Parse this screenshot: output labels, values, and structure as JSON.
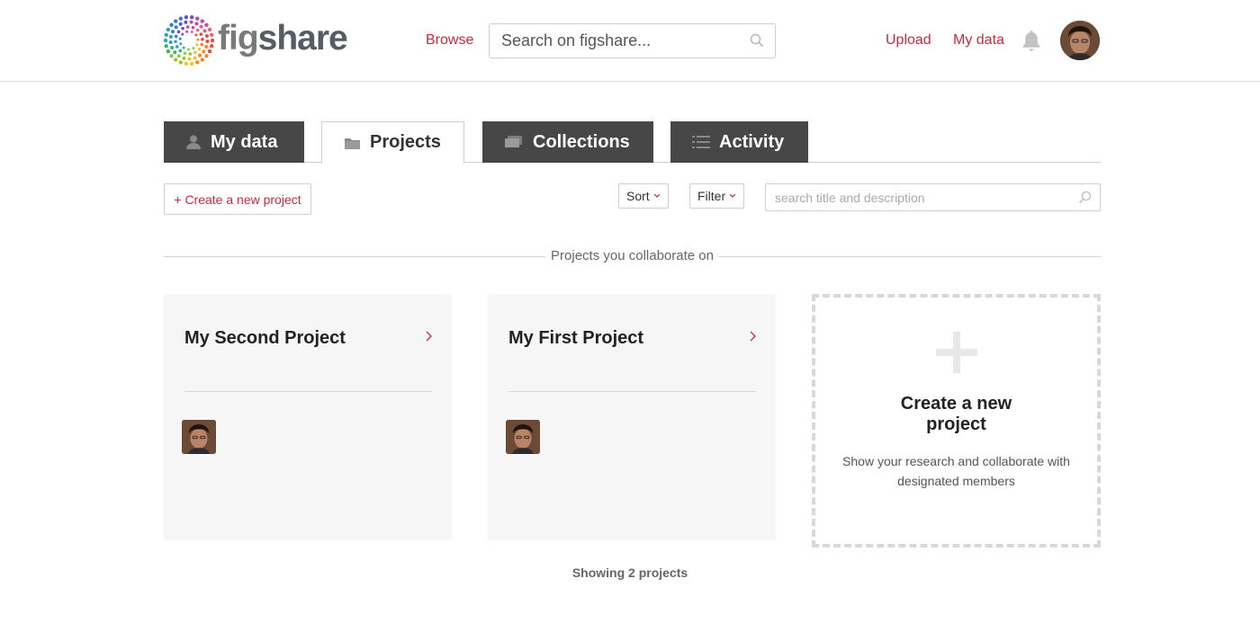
{
  "header": {
    "logo_fig": "fig",
    "logo_share": "share",
    "nav_browse": "Browse",
    "search_placeholder": "Search on figshare...",
    "nav_upload": "Upload",
    "nav_mydata": "My data",
    "icons": [
      "search-icon",
      "bell-icon"
    ]
  },
  "tabs": [
    {
      "label": "My data",
      "icon": "user-icon",
      "active": false
    },
    {
      "label": "Projects",
      "icon": "folder-icon",
      "active": true
    },
    {
      "label": "Collections",
      "icon": "collections-icon",
      "active": false
    },
    {
      "label": "Activity",
      "icon": "list-icon",
      "active": false
    }
  ],
  "toolbar": {
    "create_label": "+ Create a new project",
    "sort_label": "Sort",
    "filter_label": "Filter",
    "search_placeholder": "search title and description"
  },
  "section_label": "Projects you collaborate on",
  "projects": [
    {
      "title": "My Second Project"
    },
    {
      "title": "My First Project"
    }
  ],
  "new_project": {
    "title": "Create a new project",
    "description": "Show your research and collaborate with designated members"
  },
  "footer": {
    "count_label": "Showing 2 projects"
  },
  "colors": {
    "accent": "#c8283c",
    "tab_dark": "#474747",
    "card_bg": "#f6f6f6"
  }
}
